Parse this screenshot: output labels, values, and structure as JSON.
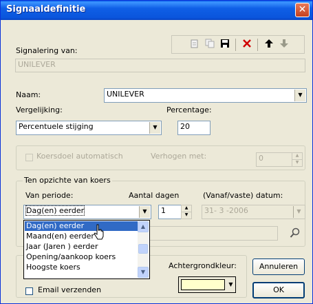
{
  "window": {
    "title": "Signaaldefinitie",
    "close_glyph": "✕"
  },
  "toolbar": {
    "icons": [
      "new-icon",
      "copy-icon",
      "save-icon",
      "delete-icon",
      "move-up-icon",
      "move-down-icon"
    ]
  },
  "signalering": {
    "label": "Signalering van:",
    "value": "UNILEVER"
  },
  "naam": {
    "label": "Naam:",
    "value": "UNILEVER"
  },
  "vergelijking": {
    "label": "Vergelijking:",
    "value": "Percentuele stijging"
  },
  "percentage": {
    "label": "Percentage:",
    "value": "20"
  },
  "koersdoel": {
    "checkbox_label": "Koersdoel automatisch",
    "verhogen_label": "Verhogen met:",
    "verhogen_value": "0"
  },
  "koers_group": {
    "title": "Ten opzichte van koers",
    "periode_label": "Van periode:",
    "periode_value": "Dag(en) eerder",
    "aantal_label": "Aantal dagen",
    "aantal_value": "1",
    "datum_label": "(Vanaf/vaste) datum:",
    "datum_value": "31- 3 -2006"
  },
  "periode_options": [
    "Dag(en) eerder",
    "Maand(en) eerder",
    "Jaar (Jaren ) eerder",
    "Opening/aankoop koers",
    "Hoogste koers"
  ],
  "achtergrondkleur": {
    "label": "Achtergrondkleur:",
    "color": "#ffffcc"
  },
  "email": {
    "label": "Email verzenden"
  },
  "buttons": {
    "cancel": "Annuleren",
    "ok": "OK"
  },
  "colors": {
    "title_bar": "#0a55dc",
    "selection": "#316ac5",
    "dialog_bg": "#ece9d8"
  }
}
